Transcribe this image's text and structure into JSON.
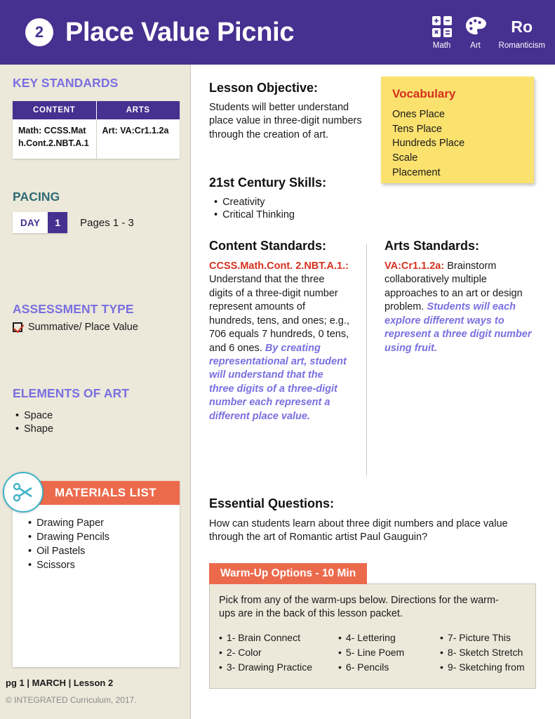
{
  "header": {
    "lesson_number": "2",
    "title": "Place Value Picnic",
    "subjects": [
      {
        "icon": "calculator-icon",
        "label": "Math"
      },
      {
        "icon": "paint-palette-icon",
        "label": "Art"
      },
      {
        "icon": "ro-text-icon",
        "glyph": "Ro",
        "label": "Romanticism"
      }
    ]
  },
  "sidebar": {
    "key_standards": {
      "heading": "KEY STANDARDS",
      "columns": [
        "CONTENT",
        "ARTS"
      ],
      "rows": [
        [
          "Math: CCSS.Math.Cont.2.NBT.A.1",
          "Art: VA:Cr1.1.2a"
        ]
      ]
    },
    "pacing": {
      "heading": "PACING",
      "day_label": "DAY",
      "day_number": "1",
      "pages": "Pages 1 - 3"
    },
    "assessment": {
      "heading": "ASSESSMENT TYPE",
      "items": [
        {
          "checked": true,
          "label": "Summative/ Place Value"
        }
      ]
    },
    "elements_of_art": {
      "heading": "ELEMENTS OF ART",
      "items": [
        "Space",
        "Shape"
      ]
    },
    "materials": {
      "heading": "MATERIALS LIST",
      "icon": "scissors-icon",
      "items": [
        "Drawing Paper",
        "Drawing Pencils",
        "Oil Pastels",
        "Scissors"
      ]
    },
    "footer": {
      "line": "pg 1  |  MARCH  |  Lesson 2",
      "copyright": "© INTEGRATED Curriculum, 2017."
    }
  },
  "main": {
    "lesson_objective": {
      "heading": "Lesson Objective:",
      "text": "Students will better understand place value in three-digit numbers through the creation of art."
    },
    "skills": {
      "heading": "21st Century Skills:",
      "items": [
        "Creativity",
        "Critical Thinking"
      ]
    },
    "vocabulary": {
      "title": "Vocabulary",
      "terms": [
        "Ones Place",
        "Tens Place",
        "Hundreds Place",
        "Scale",
        "Placement"
      ]
    },
    "content_standards": {
      "heading": "Content Standards:",
      "code": "CCSS.Math.Cont. 2.NBT.A.1.:",
      "text": "Understand that the three digits of a three-digit number represent amounts of hundreds, tens, and ones; e.g., 706 equals 7 hundreds, 0 tens, and 6 ones.",
      "note": "By creating representational art, student will understand that the three digits of a three-digit number each represent a different place value."
    },
    "arts_standards": {
      "heading": "Arts Standards:",
      "code": "VA:Cr1.1.2a:",
      "text": "Brainstorm collaboratively multiple approaches to an art or design problem.",
      "note": "Students will each explore different ways to represent a three digit number using fruit."
    },
    "essential_questions": {
      "heading": "Essential Questions:",
      "text": "How can students learn about three digit numbers and place value through the art of Romantic artist Paul Gauguin?"
    },
    "warm_up": {
      "tab_label": "Warm-Up Options - 10 Min",
      "intro": "Pick from any of the warm-ups below.  Directions for the warm-ups are in the back of this lesson packet.",
      "columns": [
        [
          "1- Brain Connect",
          "2- Color",
          "3- Drawing Practice"
        ],
        [
          "4- Lettering",
          "5- Line Poem",
          "6- Pencils"
        ],
        [
          "7- Picture This",
          "8- Sketch Stretch",
          "9- Sketching from"
        ]
      ]
    }
  },
  "colors": {
    "purple": "#463090",
    "lavender": "#7a6fe0",
    "teal_heading": "#2e6b74",
    "orange": "#ec6a4c",
    "yellow": "#fbe16e",
    "red": "#d6301f",
    "cream": "#ece8da",
    "scissors_teal": "#3fb3c6"
  }
}
